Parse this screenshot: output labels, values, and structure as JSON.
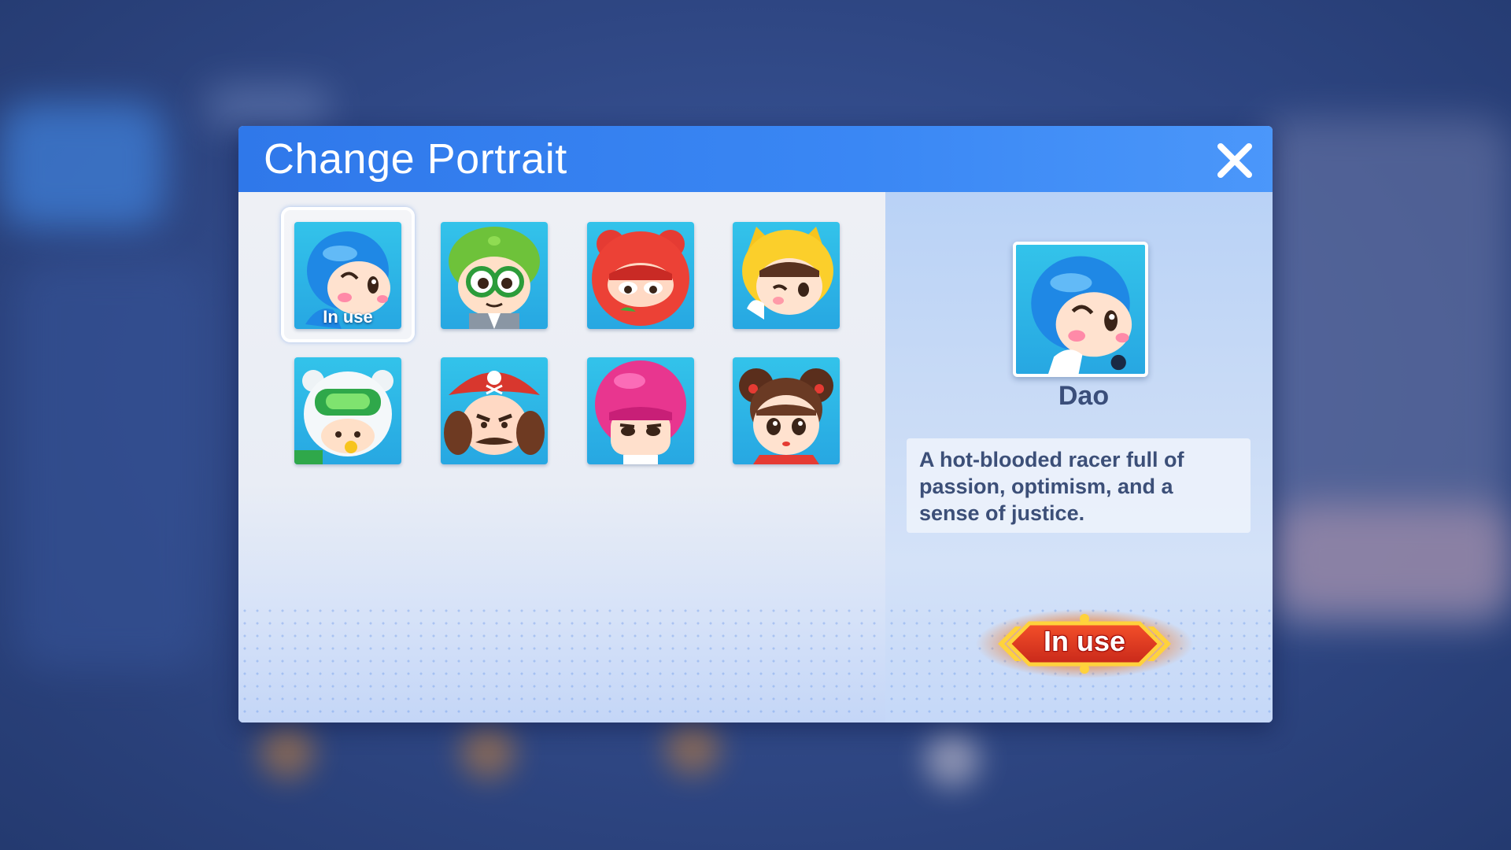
{
  "dialog": {
    "title": "Change Portrait",
    "close_icon": "close-icon"
  },
  "portraits": [
    {
      "name": "Dao",
      "selected": true,
      "badge": "In use",
      "theme": "blue-helmet"
    },
    {
      "theme": "green-cap-glasses"
    },
    {
      "theme": "red-hood"
    },
    {
      "theme": "yellow-cat-hood"
    },
    {
      "theme": "white-bear-goggles"
    },
    {
      "theme": "pirate-hat"
    },
    {
      "theme": "pink-hair"
    },
    {
      "theme": "girl-buns"
    }
  ],
  "detail": {
    "name": "Dao",
    "description": "A hot-blooded racer full of passion, optimism, and a sense of justice.",
    "action_label": "In use"
  },
  "colors": {
    "title_bar": "#3a87f4",
    "tile_bg": "#2bb3e6",
    "action_button": "#e0601c"
  }
}
